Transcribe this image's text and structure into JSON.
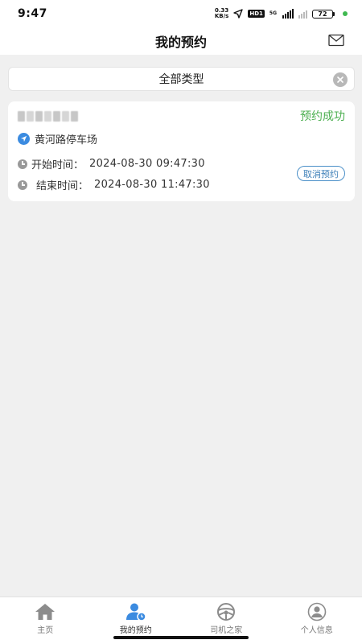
{
  "status_bar": {
    "time": "9:47",
    "net_speed_value": "0.33",
    "net_speed_unit": "KB/s",
    "hd_label": "HD1",
    "network_label": "5G",
    "battery": "72"
  },
  "header": {
    "title": "我的预约",
    "mail_icon": "mail-icon"
  },
  "filter": {
    "label": "全部类型",
    "clear_icon": "close-circle-icon"
  },
  "reservation": {
    "status": "预约成功",
    "location": "黄河路停车场",
    "start_label": "开始时间：",
    "start_time": "2024-08-30 09:47:30",
    "end_label": "结束时间：",
    "end_time": "2024-08-30 11:47:30",
    "cancel_label": "取消预约"
  },
  "tabs": [
    {
      "label": "主页",
      "icon": "home-icon"
    },
    {
      "label": "我的预约",
      "icon": "user-clock-icon"
    },
    {
      "label": "司机之家",
      "icon": "steering-wheel-icon"
    },
    {
      "label": "个人信息",
      "icon": "profile-icon"
    }
  ],
  "colors": {
    "accent_blue": "#3b8be0",
    "success_green": "#4caf50",
    "background": "#f0f0f0"
  }
}
